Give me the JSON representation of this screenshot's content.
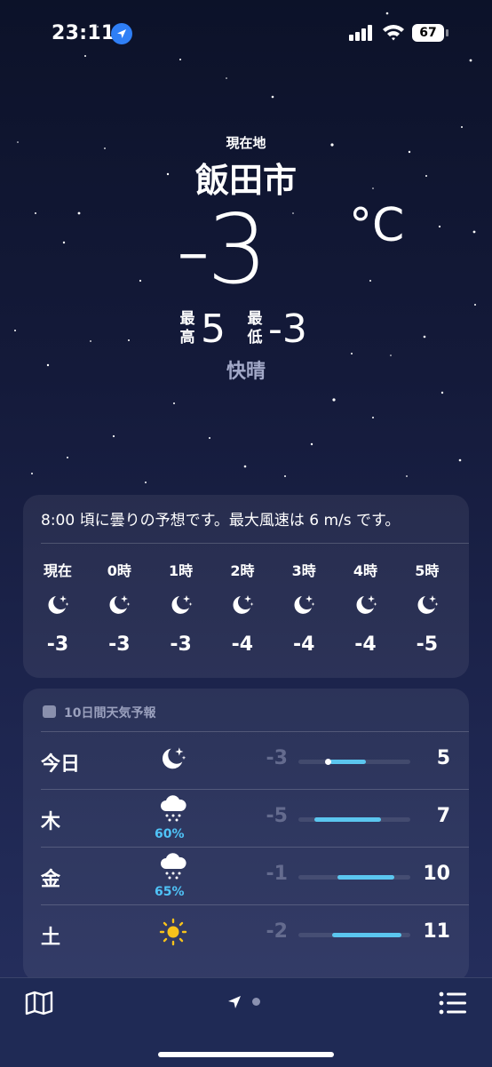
{
  "status_bar": {
    "time": "23:11",
    "battery": "67"
  },
  "location": {
    "label": "現在地",
    "city": "飯田市"
  },
  "current": {
    "temp": "-3",
    "unit": "°C",
    "high_label": "最高",
    "high": "5",
    "low_label": "最低",
    "low": "-3",
    "condition": "快晴"
  },
  "hourly": {
    "summary": "8:00 頃に曇りの予想です。最大風速は 6 m/s です。",
    "items": [
      {
        "label": "現在",
        "icon": "moon-stars-icon",
        "temp": "-3"
      },
      {
        "label": "0時",
        "icon": "moon-stars-icon",
        "temp": "-3"
      },
      {
        "label": "1時",
        "icon": "moon-stars-icon",
        "temp": "-3"
      },
      {
        "label": "2時",
        "icon": "moon-stars-icon",
        "temp": "-4"
      },
      {
        "label": "3時",
        "icon": "moon-stars-icon",
        "temp": "-4"
      },
      {
        "label": "4時",
        "icon": "moon-stars-icon",
        "temp": "-4"
      },
      {
        "label": "5時",
        "icon": "moon-stars-icon",
        "temp": "-5"
      }
    ]
  },
  "daily": {
    "title": "10日間天気予報",
    "rows": [
      {
        "day": "今日",
        "icon": "moon-stars-icon",
        "precip": "",
        "low": "-3",
        "high": "5",
        "range_start": 0.28,
        "range_end": 0.6,
        "current_pos": 0.26
      },
      {
        "day": "木",
        "icon": "cloud-snow-icon",
        "precip": "60%",
        "low": "-5",
        "high": "7",
        "range_start": 0.14,
        "range_end": 0.74
      },
      {
        "day": "金",
        "icon": "cloud-snow-icon",
        "precip": "65%",
        "low": "-1",
        "high": "10",
        "range_start": 0.35,
        "range_end": 0.86
      },
      {
        "day": "土",
        "icon": "sun-icon",
        "precip": "",
        "low": "-2",
        "high": "11",
        "range_start": 0.3,
        "range_end": 0.92
      }
    ]
  },
  "colors": {
    "accent": "#5bc6ef",
    "precip": "#4fc3f7",
    "location_arrow": "#2f7ff6"
  }
}
